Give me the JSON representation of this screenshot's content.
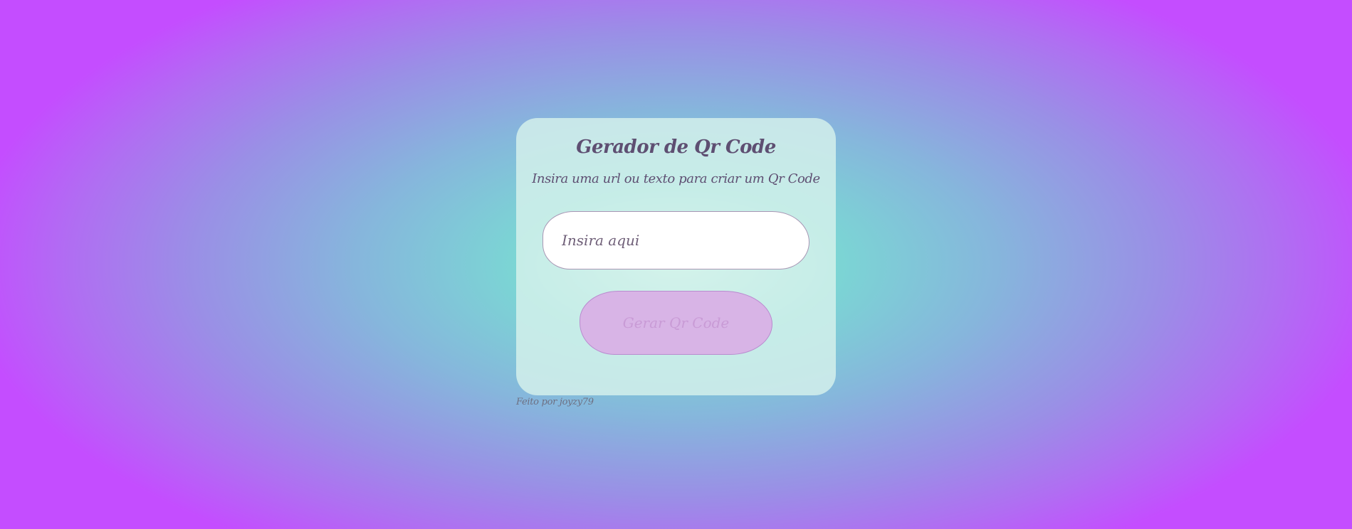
{
  "form": {
    "title": "Gerador de Qr Code",
    "subtitle": "Insira uma url ou texto para criar um Qr Code",
    "input": {
      "value": "",
      "placeholder": "Insira aqui"
    },
    "button_label": "Gerar Qr Code"
  },
  "footer": {
    "credit": "Feito por joyzy79"
  },
  "colors": {
    "text": "#5e4f72",
    "card_bg": "#c6ece7",
    "button_bg": "#d8b4e6",
    "gradient_center": "#c3f5e6",
    "gradient_edge": "#c44dff"
  }
}
